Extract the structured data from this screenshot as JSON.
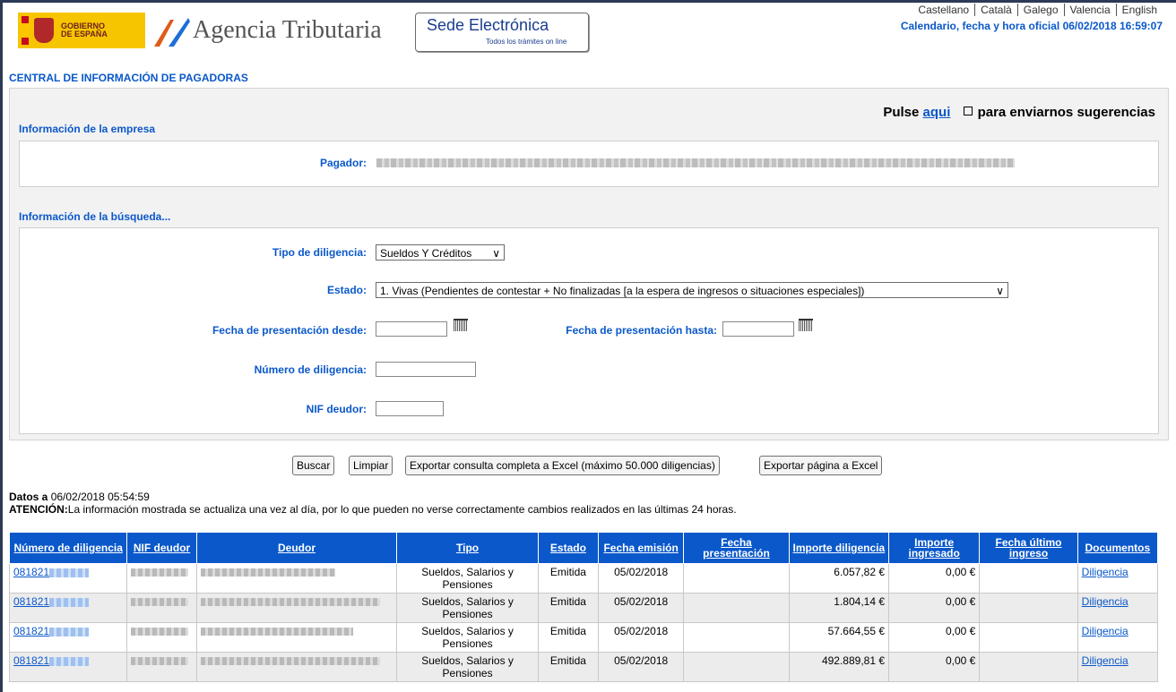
{
  "header": {
    "gob_line1": "GOBIERNO",
    "gob_line2": "DE ESPAÑA",
    "agency": "Agencia Tributaria",
    "sede_title": "Sede Electrónica",
    "sede_sub": "Todos los trámites on line",
    "languages": [
      "Castellano",
      "Català",
      "Galego",
      "Valencia",
      "English"
    ],
    "clock": "Calendario, fecha y hora oficial 06/02/2018 16:59:07"
  },
  "page_title": "CENTRAL DE INFORMACIÓN DE PAGADORAS",
  "suggestions": {
    "prefix": "Pulse",
    "link": "aqui",
    "suffix": "para enviarnos sugerencias"
  },
  "empresa": {
    "title": "Información de la empresa",
    "pagador_label": "Pagador:"
  },
  "busqueda": {
    "title": "Información de la búsqueda...",
    "tipo_label": "Tipo de diligencia:",
    "tipo_value": "Sueldos Y Créditos",
    "estado_label": "Estado:",
    "estado_value": "1. Vivas (Pendientes de contestar + No finalizadas [a la espera de ingresos o situaciones especiales])",
    "desde_label": "Fecha de presentación desde:",
    "hasta_label": "Fecha de presentación hasta:",
    "numero_label": "Número de diligencia:",
    "nif_label": "NIF deudor:"
  },
  "buttons": {
    "buscar": "Buscar",
    "limpiar": "Limpiar",
    "export_all": "Exportar consulta completa a Excel (máximo 50.000 diligencias)",
    "export_page": "Exportar página a Excel"
  },
  "datos": {
    "label": "Datos a",
    "date": "06/02/2018 05:54:59",
    "atencion_label": "ATENCIÓN:",
    "atencion_text": "La información mostrada se actualiza una vez al día, por lo que pueden no verse correctamente cambios realizados en las últimas 24 horas."
  },
  "table": {
    "headers": [
      "Número de diligencia",
      "NIF deudor",
      "Deudor",
      "Tipo",
      "Estado",
      "Fecha emisión",
      "Fecha presentación",
      "Importe diligencia",
      "Importe ingresado",
      "Fecha último ingreso",
      "Documentos"
    ],
    "rows": [
      {
        "numero": "081821",
        "tipo": "Sueldos, Salarios y Pensiones",
        "estado": "Emitida",
        "emision": "05/02/2018",
        "presentacion": "",
        "importe": "6.057,82 €",
        "ingresado": "0,00 €",
        "ultimo": "",
        "doc": "Diligencia"
      },
      {
        "numero": "081821",
        "tipo": "Sueldos, Salarios y Pensiones",
        "estado": "Emitida",
        "emision": "05/02/2018",
        "presentacion": "",
        "importe": "1.804,14 €",
        "ingresado": "0,00 €",
        "ultimo": "",
        "doc": "Diligencia"
      },
      {
        "numero": "081821",
        "tipo": "Sueldos, Salarios y Pensiones",
        "estado": "Emitida",
        "emision": "05/02/2018",
        "presentacion": "",
        "importe": "57.664,55 €",
        "ingresado": "0,00 €",
        "ultimo": "",
        "doc": "Diligencia"
      },
      {
        "numero": "081821",
        "tipo": "Sueldos, Salarios y Pensiones",
        "estado": "Emitida",
        "emision": "05/02/2018",
        "presentacion": "",
        "importe": "492.889,81 €",
        "ingresado": "0,00 €",
        "ultimo": "",
        "doc": "Diligencia"
      }
    ]
  }
}
